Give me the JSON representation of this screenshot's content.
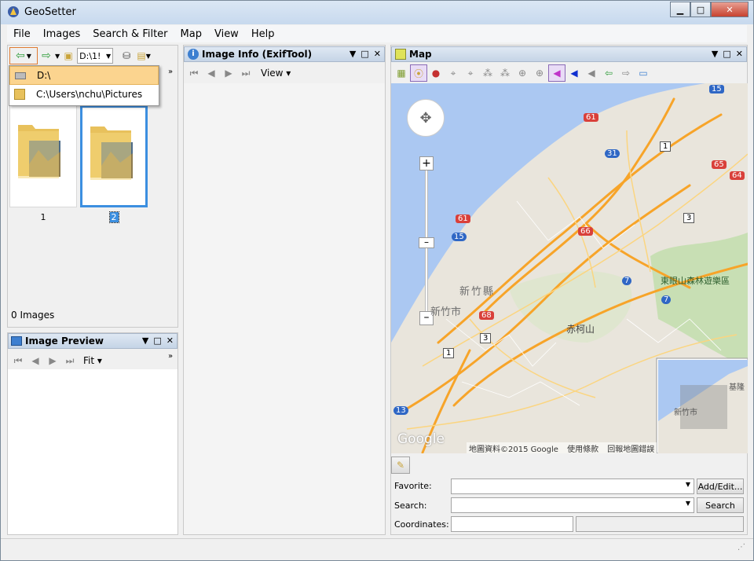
{
  "window": {
    "title": "GeoSetter",
    "controls": [
      "minimize",
      "maximize",
      "close"
    ]
  },
  "menu": [
    "File",
    "Images",
    "Search & Filter",
    "Map",
    "View",
    "Help"
  ],
  "left": {
    "path_value": "D:\\1!",
    "dropdown": [
      {
        "label": "D:\\",
        "icon": "drive-icon",
        "selected": true
      },
      {
        "label": "C:\\Users\\nchu\\Pictures",
        "icon": "folder-pictures-icon",
        "selected": false
      }
    ],
    "thumbs": [
      {
        "caption": "1",
        "selected": false
      },
      {
        "caption": "2",
        "selected": true
      }
    ],
    "status": "0 Images"
  },
  "preview": {
    "title": "Image Preview",
    "fit_label": "Fit"
  },
  "info": {
    "title": "Image Info (ExifTool)",
    "view_label": "View"
  },
  "mapp": {
    "title": "Map",
    "attribution": "地圖資料©2015 Google",
    "terms": "使用條款",
    "report": "回報地圖錯誤",
    "google": "Google",
    "places": [
      {
        "t": "東眼山森林遊樂區"
      },
      {
        "t": "新竹縣"
      },
      {
        "t": "新竹市"
      },
      {
        "t": "赤柯山"
      },
      {
        "t": "新竹市"
      },
      {
        "t": "基隆"
      }
    ],
    "shields": [
      "15",
      "61",
      "31",
      "1",
      "65",
      "64",
      "3",
      "61",
      "15",
      "66",
      "7",
      "7",
      "68",
      "3",
      "1",
      "13"
    ],
    "favorite_label": "Favorite:",
    "search_label": "Search:",
    "coords_label": "Coordinates:",
    "favorite_btn": "Add/Edit...",
    "search_btn": "Search"
  },
  "colors": {
    "accent": "#3c8fe0",
    "selected": "#fbd48f",
    "road": "#f7a429",
    "sea": "#abc8f2",
    "land": "#e9e5dc"
  }
}
